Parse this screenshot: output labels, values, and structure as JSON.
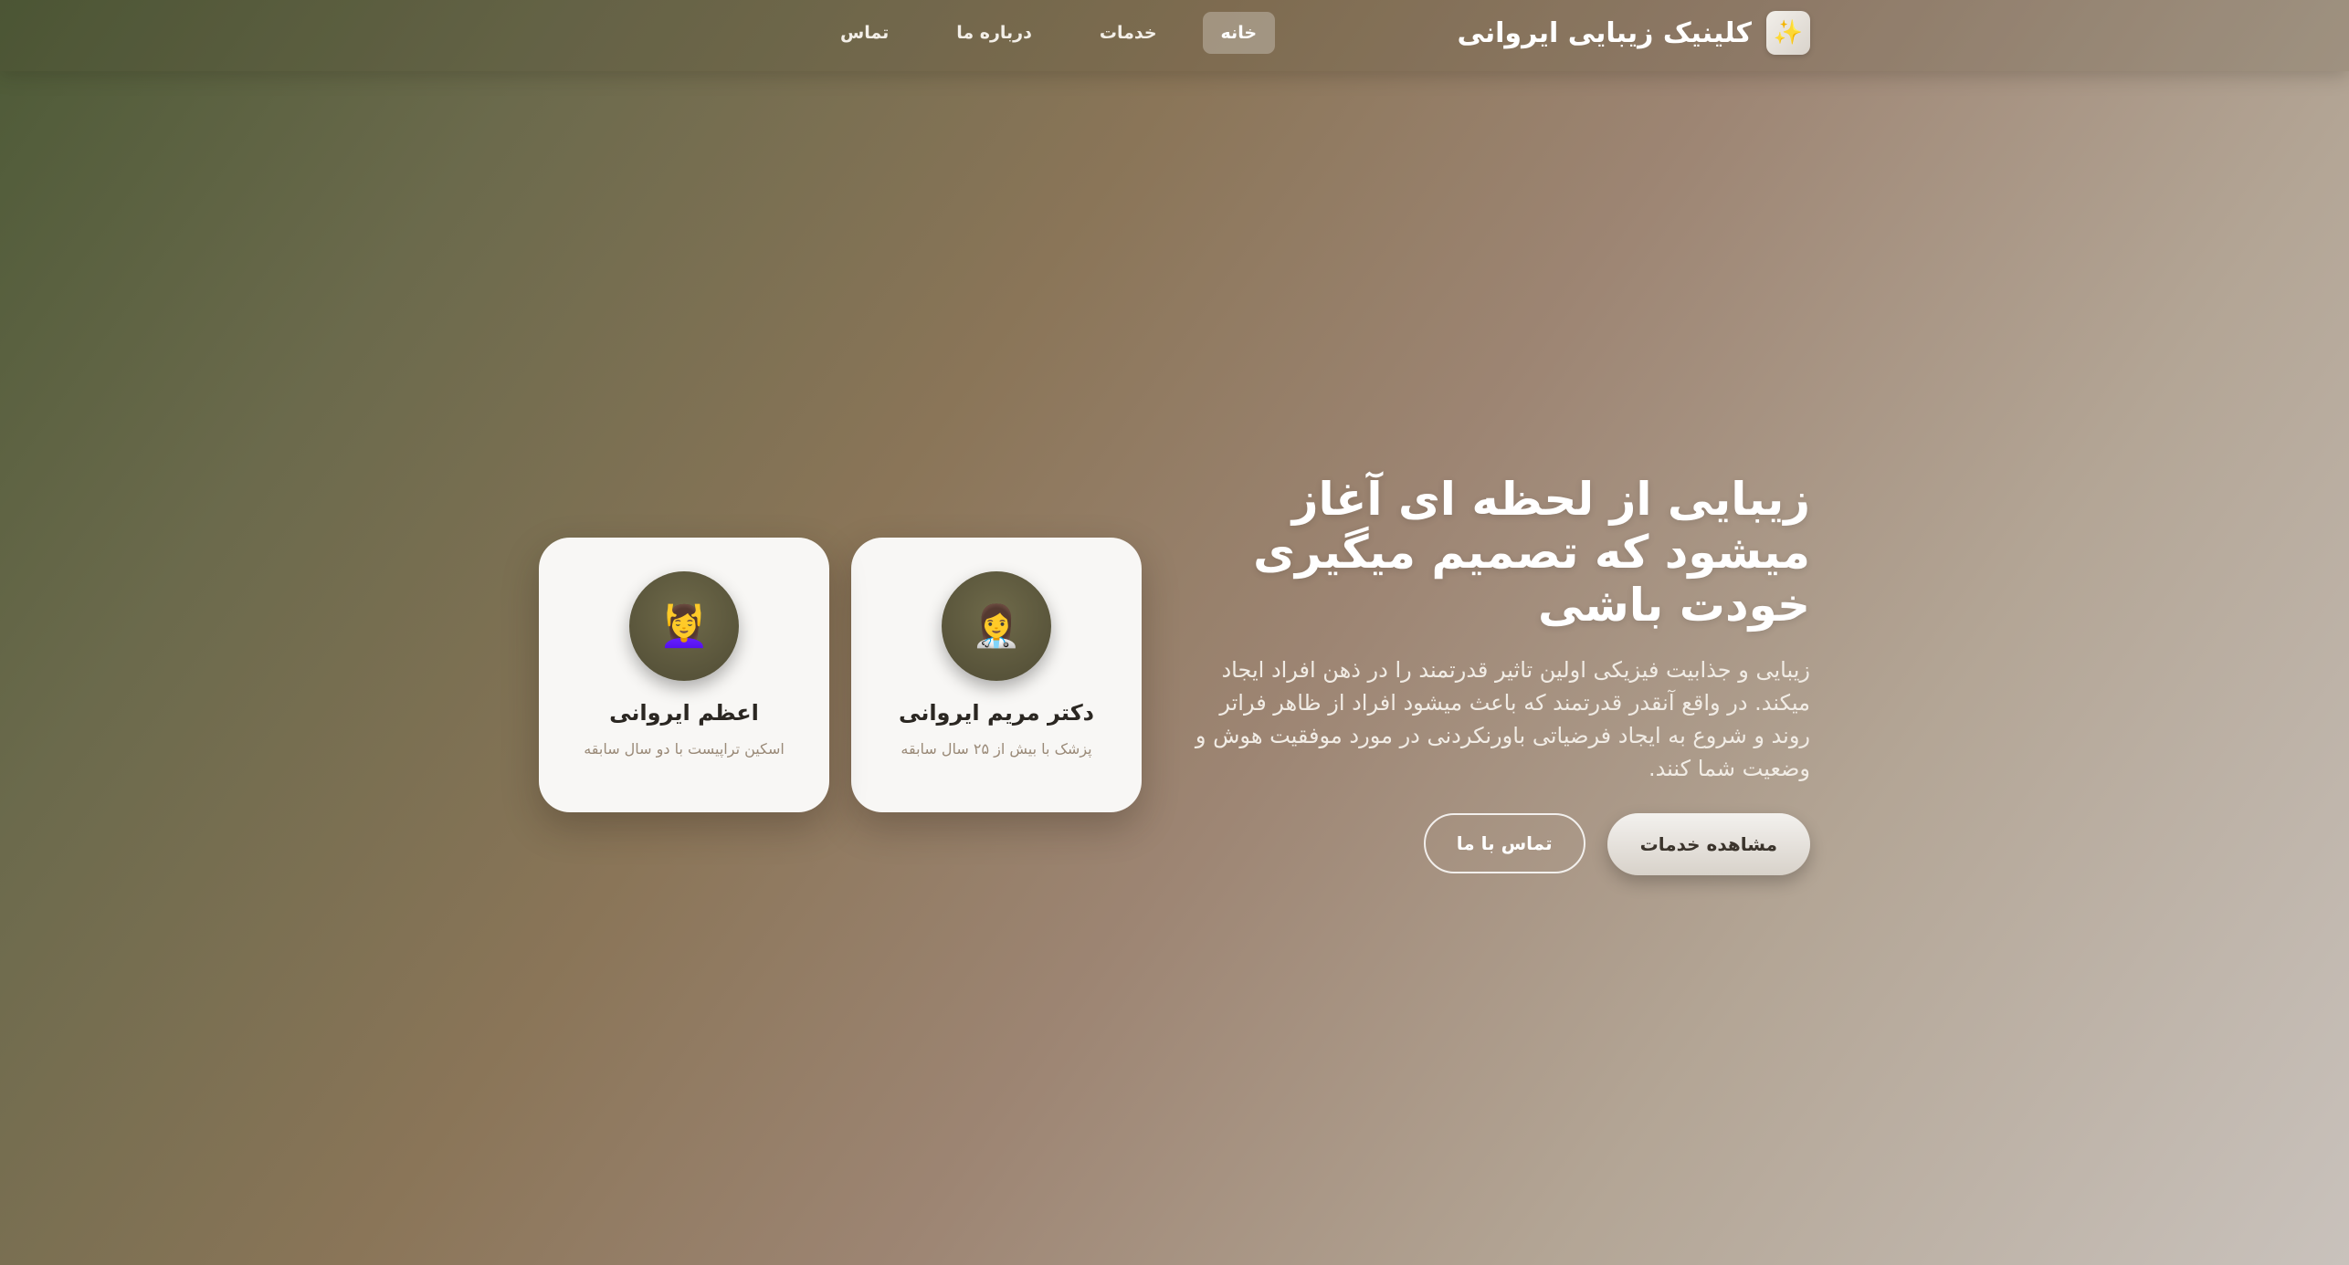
{
  "header": {
    "brand_name": "کلینیک زیبایی ایروانی",
    "brand_icon": "sparkles-icon",
    "nav": [
      {
        "label": "خانه",
        "active": true
      },
      {
        "label": "خدمات",
        "active": false
      },
      {
        "label": "درباره ما",
        "active": false
      },
      {
        "label": "تماس",
        "active": false
      }
    ]
  },
  "hero": {
    "title": "زیبایی از لحظه ای آغاز میشود که تصمیم میگیری خودت باشی",
    "description": "زیبایی و جذابیت فیزیکی اولین تاثیر قدرتمند را در ذهن افراد ایجاد میکند. در واقع آنقدر قدرتمند که باعث میشود افراد از ظاهر فراتر روند و شروع به ایجاد فرضیاتی باورنکردنی در مورد موفقیت هوش و وضعیت شما کنند.",
    "primary_button": "مشاهده خدمات",
    "secondary_button": "تماس با ما"
  },
  "cards": [
    {
      "name": "دکتر مریم ایروانی",
      "role": "پزشک با بیش از ۲۵ سال سابقه",
      "icon": "doctor-icon"
    },
    {
      "name": "اعظم ایروانی",
      "role": "اسکین تراپیست با دو سال سابقه",
      "icon": "facial-massage-icon"
    }
  ],
  "colors": {
    "background_start": "#4d5a37",
    "background_end": "#c9c2bc",
    "card_background": "#f8f7f5",
    "avatar_background": "#5f5a3f"
  }
}
